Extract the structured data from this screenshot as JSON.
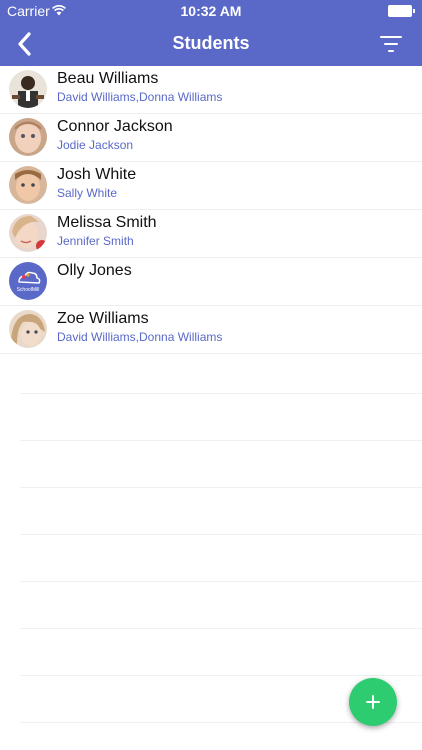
{
  "status_bar": {
    "carrier": "Carrier",
    "time": "10:32 AM"
  },
  "nav": {
    "title": "Students",
    "back_icon": "chevron-left-icon",
    "filter_icon": "filter-icon"
  },
  "colors": {
    "header": "#5a69c8",
    "accent_text": "#5a69c8",
    "fab": "#2ecc71"
  },
  "students": [
    {
      "name": "Beau Williams",
      "parents": "David Williams,Donna Williams"
    },
    {
      "name": "Connor Jackson",
      "parents": "Jodie Jackson"
    },
    {
      "name": "Josh White",
      "parents": "Sally White"
    },
    {
      "name": "Melissa Smith",
      "parents": "Jennifer Smith"
    },
    {
      "name": "Olly Jones",
      "parents": ""
    },
    {
      "name": "Zoe Williams",
      "parents": "David Williams,Donna Williams"
    }
  ],
  "fab": {
    "label": "+",
    "icon": "plus-icon"
  },
  "avatar_logo_text": "SchoolMill"
}
